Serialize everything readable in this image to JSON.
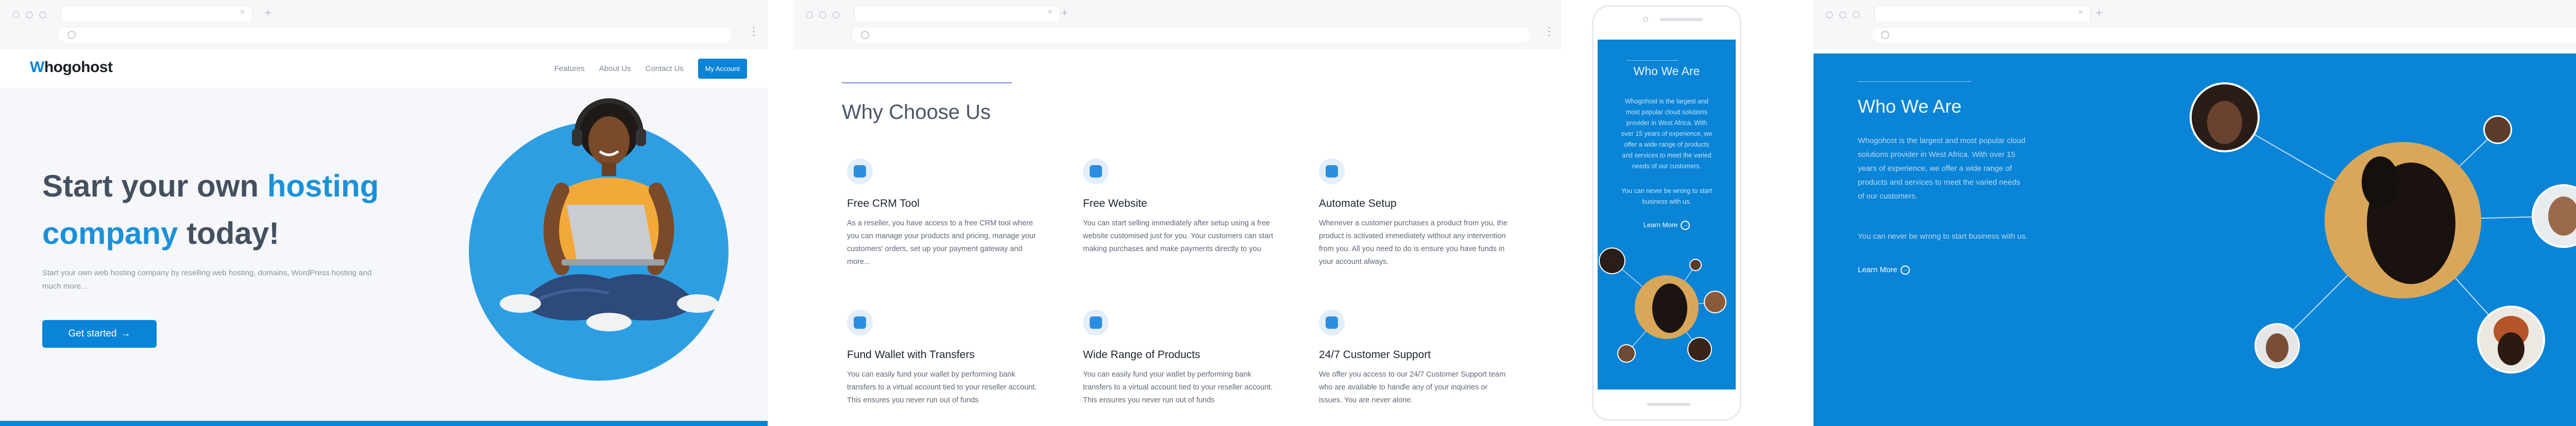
{
  "colors": {
    "brand": "#0a84d6",
    "hero_bg": "#f5f7fa",
    "gold": "#d9a75a"
  },
  "browser": {
    "tab_close": "×",
    "new_tab": "+",
    "menu": "⋮"
  },
  "panel1": {
    "logo_prefix": "W",
    "logo_rest": "hogohost",
    "nav": {
      "features": "Features",
      "about": "About Us",
      "contact": "Contact Us",
      "account": "My Account"
    },
    "hero": {
      "title_part1": "Start your own ",
      "title_highlight1": "hosting",
      "title_highlight2": "company",
      "title_part2": " today!",
      "subtitle": "Start your own web hosting company by reselling web hosting, domains, WordPress hosting and much more...",
      "cta_label": "Get started",
      "cta_arrow": "→"
    }
  },
  "panel2": {
    "title": "Why Choose Us",
    "features": [
      {
        "icon": "crm-icon",
        "title": "Free CRM Tool",
        "desc": "As a reseller, you have access to a free CRM tool where you can manage your products and pricing, manage your customers' orders, set up your payment gateway and more..."
      },
      {
        "icon": "website-icon",
        "title": "Free Website",
        "desc": "You can start selling immediately after setup using a free website customised just for you. Your customers can start making purchases and make payments directly to you"
      },
      {
        "icon": "automate-icon",
        "title": "Automate Setup",
        "desc": "Whenever a customer purchases a product from you, the product is activated immediately without any intervention from you. All you need to do is ensure you have funds in your account always."
      },
      {
        "icon": "wallet-icon",
        "title": "Fund Wallet with Transfers",
        "desc": "You can easily fund your wallet by performing bank transfers to a virtual account tied to your reseller account. This ensures you never run out of funds"
      },
      {
        "icon": "products-icon",
        "title": "Wide Range of Products",
        "desc": "You can easily fund your wallet by performing bank transfers to a virtual account tied to your reseller account. This ensures you never run out of funds"
      },
      {
        "icon": "support-icon",
        "title": "24/7 Customer Support",
        "desc": "We offer you access to our 24/7 Customer Support team who are available to handle any of your inquiries or issues. You are never alone."
      }
    ]
  },
  "who": {
    "title": "Who We Are",
    "desc": "Whogohost is the largest and most popular cloud solutions provider in West Africa. With over 15 years of experience, we offer a wide range of products and services to meet the varied needs of our customers.",
    "desc2": "You can never be wrong to start business with us.",
    "learn_more": "Learn More",
    "learn_more_arrow": "→"
  }
}
